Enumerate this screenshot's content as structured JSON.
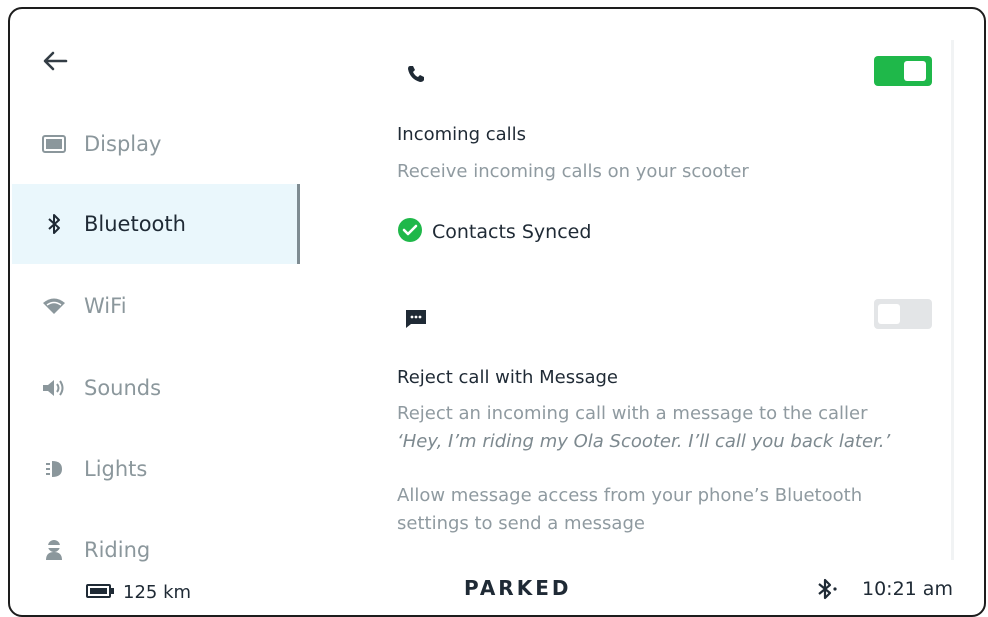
{
  "sidebar": {
    "items": [
      {
        "label": "Display",
        "icon": "display-icon"
      },
      {
        "label": "Bluetooth",
        "icon": "bluetooth-icon",
        "active": true
      },
      {
        "label": "WiFi",
        "icon": "wifi-icon"
      },
      {
        "label": "Sounds",
        "icon": "speaker-icon"
      },
      {
        "label": "Lights",
        "icon": "light-icon"
      },
      {
        "label": "Riding",
        "icon": "riding-icon"
      }
    ]
  },
  "settings": {
    "incoming_calls": {
      "title": "Incoming calls",
      "description": "Receive incoming calls on your scooter",
      "enabled": true,
      "status": "Contacts Synced"
    },
    "reject_message": {
      "title": "Reject call with Message",
      "description": "Reject an incoming call with a message to the caller",
      "message": "‘Hey, I’m riding my Ola Scooter. I’ll call you back later.’",
      "note_line1": "Allow message access from your phone’s Bluetooth",
      "note_line2": "settings to send a message",
      "enabled": false
    }
  },
  "status_bar": {
    "range": "125 km",
    "state": "PARKED",
    "time": "10:21 am"
  },
  "colors": {
    "accent_green": "#1fb84a",
    "active_bg": "#eaf7fc",
    "text_dark": "#1f2a35",
    "text_muted": "#8f9aa0"
  }
}
